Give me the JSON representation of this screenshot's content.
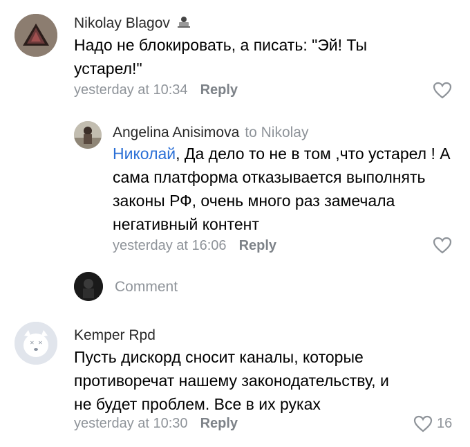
{
  "comments": [
    {
      "author": "Nikolay Blagov",
      "author_badge_icon": "user-laptop-icon",
      "text": "Надо не блокировать, а писать: \"Эй! Ты устарел!\"",
      "time": "yesterday at 10:34",
      "reply_label": "Reply",
      "likes": ""
    },
    {
      "author": "Angelina Anisimova",
      "reply_to": "to Nikolay",
      "mention": "Николай",
      "text": ", Да дело то не в том ,что устарел ! А сама платформа отказывается выполнять законы РФ, очень много раз замечала негативный контент",
      "time": "yesterday at 16:06",
      "reply_label": "Reply",
      "likes": ""
    },
    {
      "author": "Kemper Rpd",
      "text": "Пусть дискорд сносит каналы, которые противоречат нашему законодательству, и не будет проблем. Все в их руках",
      "time": "yesterday at 10:30",
      "reply_label": "Reply",
      "likes": "16"
    }
  ],
  "comment_box": {
    "placeholder": "Comment"
  },
  "colors": {
    "mention": "#2a6fd6",
    "meta": "#8e9399",
    "avatar1": "#8a7a6e",
    "avatar_dog": "#dfe3ea"
  }
}
